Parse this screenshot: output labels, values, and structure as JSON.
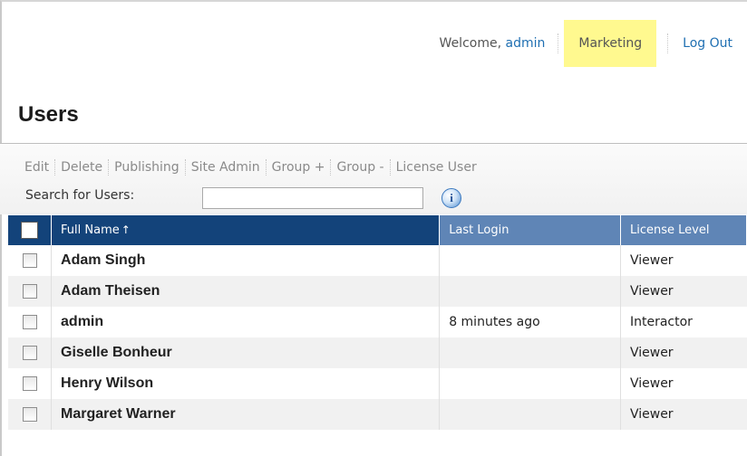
{
  "header": {
    "welcome_prefix": "Welcome,",
    "username": "admin",
    "site": "Marketing",
    "logout": "Log Out"
  },
  "page_title": "Users",
  "toolbar": {
    "actions": [
      "Edit",
      "Delete",
      "Publishing",
      "Site Admin",
      "Group +",
      "Group -",
      "License User"
    ]
  },
  "search": {
    "label": "Search for Users:",
    "value": "",
    "info_icon": "info-icon"
  },
  "table": {
    "columns": [
      "Full Name",
      "Last Login",
      "License Level"
    ],
    "sort_indicator": "↑",
    "rows": [
      {
        "name": "Adam Singh",
        "last_login": "",
        "license": "Viewer"
      },
      {
        "name": "Adam Theisen",
        "last_login": "",
        "license": "Viewer"
      },
      {
        "name": "admin",
        "last_login": "8 minutes ago",
        "license": "Interactor"
      },
      {
        "name": "Giselle Bonheur",
        "last_login": "",
        "license": "Viewer"
      },
      {
        "name": "Henry Wilson",
        "last_login": "",
        "license": "Viewer"
      },
      {
        "name": "Margaret Warner",
        "last_login": "",
        "license": "Viewer"
      }
    ]
  },
  "colors": {
    "link": "#1f6fb2",
    "site_highlight": "#fff98f",
    "header_dark": "#13437a",
    "header_light": "#5f85b6",
    "row_alt": "#f1f1f1"
  }
}
